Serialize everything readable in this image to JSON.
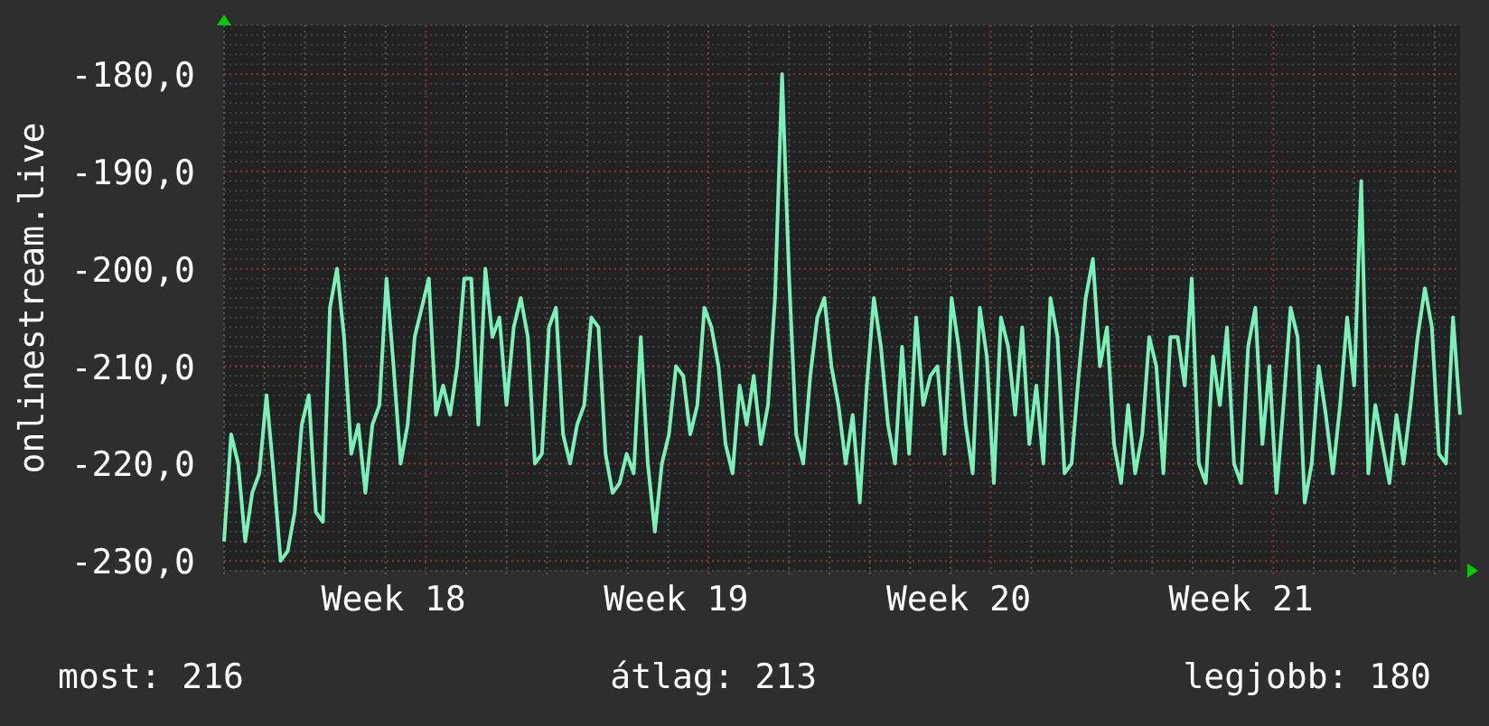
{
  "chart_data": {
    "type": "line",
    "ylabel": "onlinestream.live",
    "categories": [
      null,
      null,
      null,
      null,
      null,
      null,
      null,
      null,
      null,
      null,
      null,
      null,
      null,
      null,
      null,
      null,
      null,
      null,
      null,
      null,
      null,
      null,
      null,
      null,
      "Week 18",
      null,
      null,
      null,
      null,
      null,
      null,
      null,
      null,
      null,
      null,
      null,
      null,
      null,
      null,
      null,
      null,
      null,
      null,
      null,
      null,
      null,
      null,
      null,
      null,
      null,
      null,
      null,
      null,
      null,
      null,
      null,
      null,
      null,
      null,
      null,
      null,
      null,
      null,
      null,
      "Week 19",
      null,
      null,
      null,
      null,
      null,
      null,
      null,
      null,
      null,
      null,
      null,
      null,
      null,
      null,
      null,
      null,
      null,
      null,
      null,
      null,
      null,
      null,
      null,
      null,
      null,
      null,
      null,
      null,
      null,
      null,
      null,
      null,
      null,
      null,
      null,
      null,
      null,
      null,
      null,
      "Week 20",
      null,
      null,
      null,
      null,
      null,
      null,
      null,
      null,
      null,
      null,
      null,
      null,
      null,
      null,
      null,
      null,
      null,
      null,
      null,
      null,
      null,
      null,
      null,
      null,
      null,
      null,
      null,
      null,
      null,
      null,
      null,
      null,
      null,
      null,
      null,
      null,
      null,
      null,
      null,
      "Week 21",
      null,
      null,
      null,
      null,
      null,
      null,
      null,
      null,
      null,
      null,
      null,
      null,
      null,
      null,
      null,
      null,
      null,
      null,
      null,
      null,
      null,
      null,
      null,
      null,
      null,
      null,
      null,
      null,
      null,
      null,
      null
    ],
    "series": [
      {
        "color": "#77f2b9",
        "values": [
          -228,
          -217,
          -220,
          -228,
          -223,
          -221,
          -213,
          -221,
          -230,
          -229,
          -225,
          -216,
          -213,
          -225,
          -226,
          -204,
          -200,
          -207,
          -219,
          -216,
          -223,
          -216,
          -214,
          -201,
          -210,
          -220,
          -216,
          -207,
          -204,
          -201,
          -215,
          -212,
          -215,
          -210,
          -201,
          -201,
          -216,
          -200,
          -207,
          -205,
          -214,
          -206,
          -203,
          -207,
          -220,
          -219,
          -206,
          -204,
          -217,
          -220,
          -216,
          -214,
          -205,
          -206,
          -219,
          -223,
          -222,
          -219,
          -221,
          -207,
          -220,
          -227,
          -220,
          -217,
          -210,
          -211,
          -217,
          -214,
          -204,
          -206,
          -210,
          -218,
          -221,
          -212,
          -216,
          -211,
          -218,
          -214,
          -203,
          -180,
          -201,
          -217,
          -220,
          -211,
          -205,
          -203,
          -210,
          -214,
          -220,
          -215,
          -224,
          -212,
          -203,
          -208,
          -216,
          -220,
          -208,
          -219,
          -205,
          -214,
          -211,
          -210,
          -219,
          -203,
          -208,
          -216,
          -221,
          -204,
          -209,
          -222,
          -205,
          -208,
          -215,
          -206,
          -218,
          -212,
          -220,
          -203,
          -207,
          -221,
          -220,
          -211,
          -203,
          -199,
          -210,
          -206,
          -218,
          -222,
          -214,
          -221,
          -217,
          -207,
          -210,
          -221,
          -207,
          -207,
          -212,
          -201,
          -220,
          -222,
          -209,
          -214,
          -206,
          -220,
          -222,
          -208,
          -204,
          -218,
          -210,
          -223,
          -214,
          -204,
          -207,
          -224,
          -220,
          -210,
          -215,
          -221,
          -214,
          -205,
          -212,
          -191,
          -221,
          -214,
          -218,
          -222,
          -215,
          -220,
          -214,
          -207,
          -202,
          -206,
          -219,
          -220,
          -205,
          -215
        ]
      }
    ],
    "grid": true,
    "ylim": [
      -231,
      -175
    ],
    "yticks": [
      {
        "value": -180,
        "label": "-180,0"
      },
      {
        "value": -190,
        "label": "-190,0"
      },
      {
        "value": -200,
        "label": "-200,0"
      },
      {
        "value": -210,
        "label": "-210,0"
      },
      {
        "value": -220,
        "label": "-220,0"
      },
      {
        "value": -230,
        "label": "-230,0"
      }
    ]
  },
  "legend": [
    "most: 216",
    "átlag: 213",
    "legjobb: 180"
  ]
}
